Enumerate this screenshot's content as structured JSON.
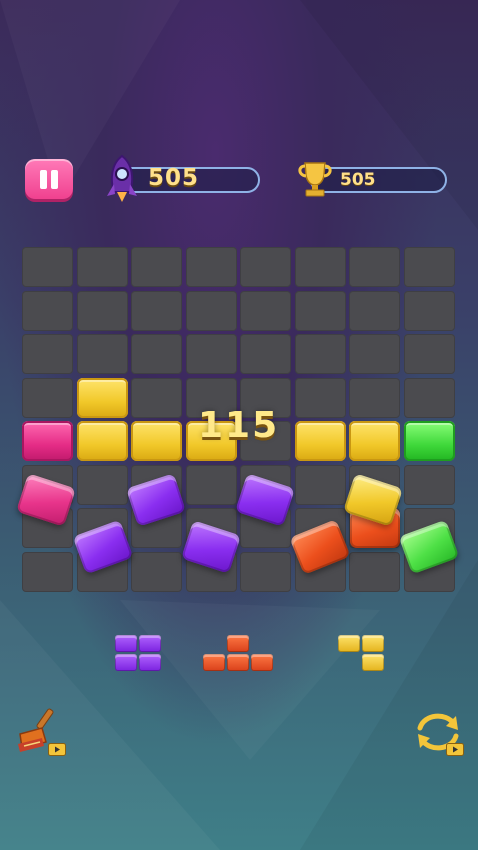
{
  "header": {
    "pause_icon": "pause-icon",
    "score_icon": "rocket-icon",
    "score": "505",
    "best_icon": "trophy-icon",
    "best_score": "505"
  },
  "board": {
    "rows": 8,
    "cols": 8,
    "grid": [
      [
        "",
        "",
        "",
        "",
        "",
        "",
        "",
        ""
      ],
      [
        "",
        "",
        "",
        "",
        "",
        "",
        "",
        ""
      ],
      [
        "",
        "",
        "",
        "",
        "",
        "",
        "",
        ""
      ],
      [
        "",
        "yellow",
        "",
        "",
        "",
        "",
        "",
        ""
      ],
      [
        "pink",
        "yellow",
        "yellow",
        "yellow",
        "",
        "yellow",
        "yellow",
        "green"
      ],
      [
        "",
        "",
        "",
        "",
        "",
        "",
        "",
        ""
      ],
      [
        "",
        "",
        "",
        "",
        "",
        "",
        "",
        ""
      ],
      [
        "",
        "",
        "",
        "",
        "",
        "",
        "",
        ""
      ]
    ],
    "clearing_tiles": [
      "pink",
      "purple",
      "purple",
      "purple",
      "purple",
      "purple",
      "orange",
      "yellow",
      "orange",
      "green"
    ]
  },
  "combo_score": "115",
  "tray": {
    "pieces": [
      {
        "name": "square-2x2",
        "color": "purple"
      },
      {
        "name": "t-shape",
        "color": "orange"
      },
      {
        "name": "l-shape",
        "color": "yellow"
      }
    ]
  },
  "boosters": {
    "left_icon": "broom-icon",
    "right_icon": "refresh-icon",
    "badge_icon": "video-ad-icon"
  },
  "colors": {
    "yellow": "#f1c829",
    "pink": "#e52c86",
    "green": "#3fd83a",
    "purple": "#8a2ef0",
    "orange": "#ec4f1c",
    "score_text": "#ffe08a",
    "pause_button": "#f0418f"
  }
}
